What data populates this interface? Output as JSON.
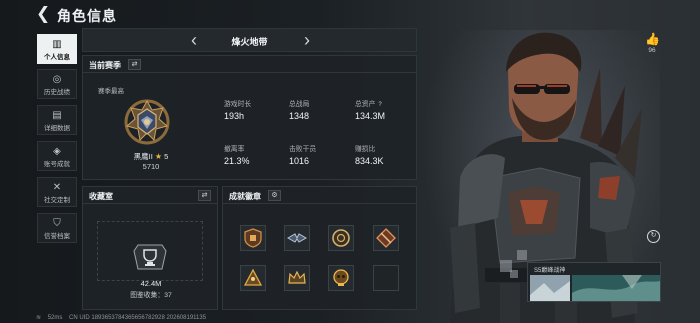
{
  "header": {
    "title": "角色信息"
  },
  "nav": [
    {
      "label": "个人信息",
      "icon": "bar-chart-icon",
      "active": true
    },
    {
      "label": "历史战绩",
      "icon": "history-icon",
      "active": false
    },
    {
      "label": "详细数据",
      "icon": "document-icon",
      "active": false
    },
    {
      "label": "账号成就",
      "icon": "achievement-icon",
      "active": false
    },
    {
      "label": "社交定制",
      "icon": "tools-icon",
      "active": false
    },
    {
      "label": "信誉档案",
      "icon": "shield-icon",
      "active": false
    }
  ],
  "map": {
    "name": "烽火地带"
  },
  "season": {
    "title": "当前赛季",
    "best_label": "赛季最高",
    "rank_name": "黑鹰II",
    "rank_stars": "5",
    "rank_score": "5710",
    "stats": [
      {
        "label": "游戏时长",
        "value": "193h"
      },
      {
        "label": "总战局",
        "value": "1348"
      },
      {
        "label": "总资产",
        "value": "134.3M",
        "help": "?"
      },
      {
        "label": "撤离率",
        "value": "21.3%"
      },
      {
        "label": "击败干员",
        "value": "1016"
      },
      {
        "label": "赚损比",
        "value": "834.3K"
      }
    ]
  },
  "collection": {
    "title": "收藏室",
    "value": "42.4M",
    "count": "图鉴收集：37"
  },
  "badges": {
    "title": "成就徽章"
  },
  "footer": {
    "signal": "52ms",
    "uid": "CN UID 1893653784365656782928 202608191135"
  },
  "character": {
    "likes": "96"
  },
  "skin": {
    "label": "S5巅峰战神"
  },
  "colors": {
    "accent": "#eef1f2",
    "gold": "#e7b443",
    "panel": "#1e2327"
  }
}
